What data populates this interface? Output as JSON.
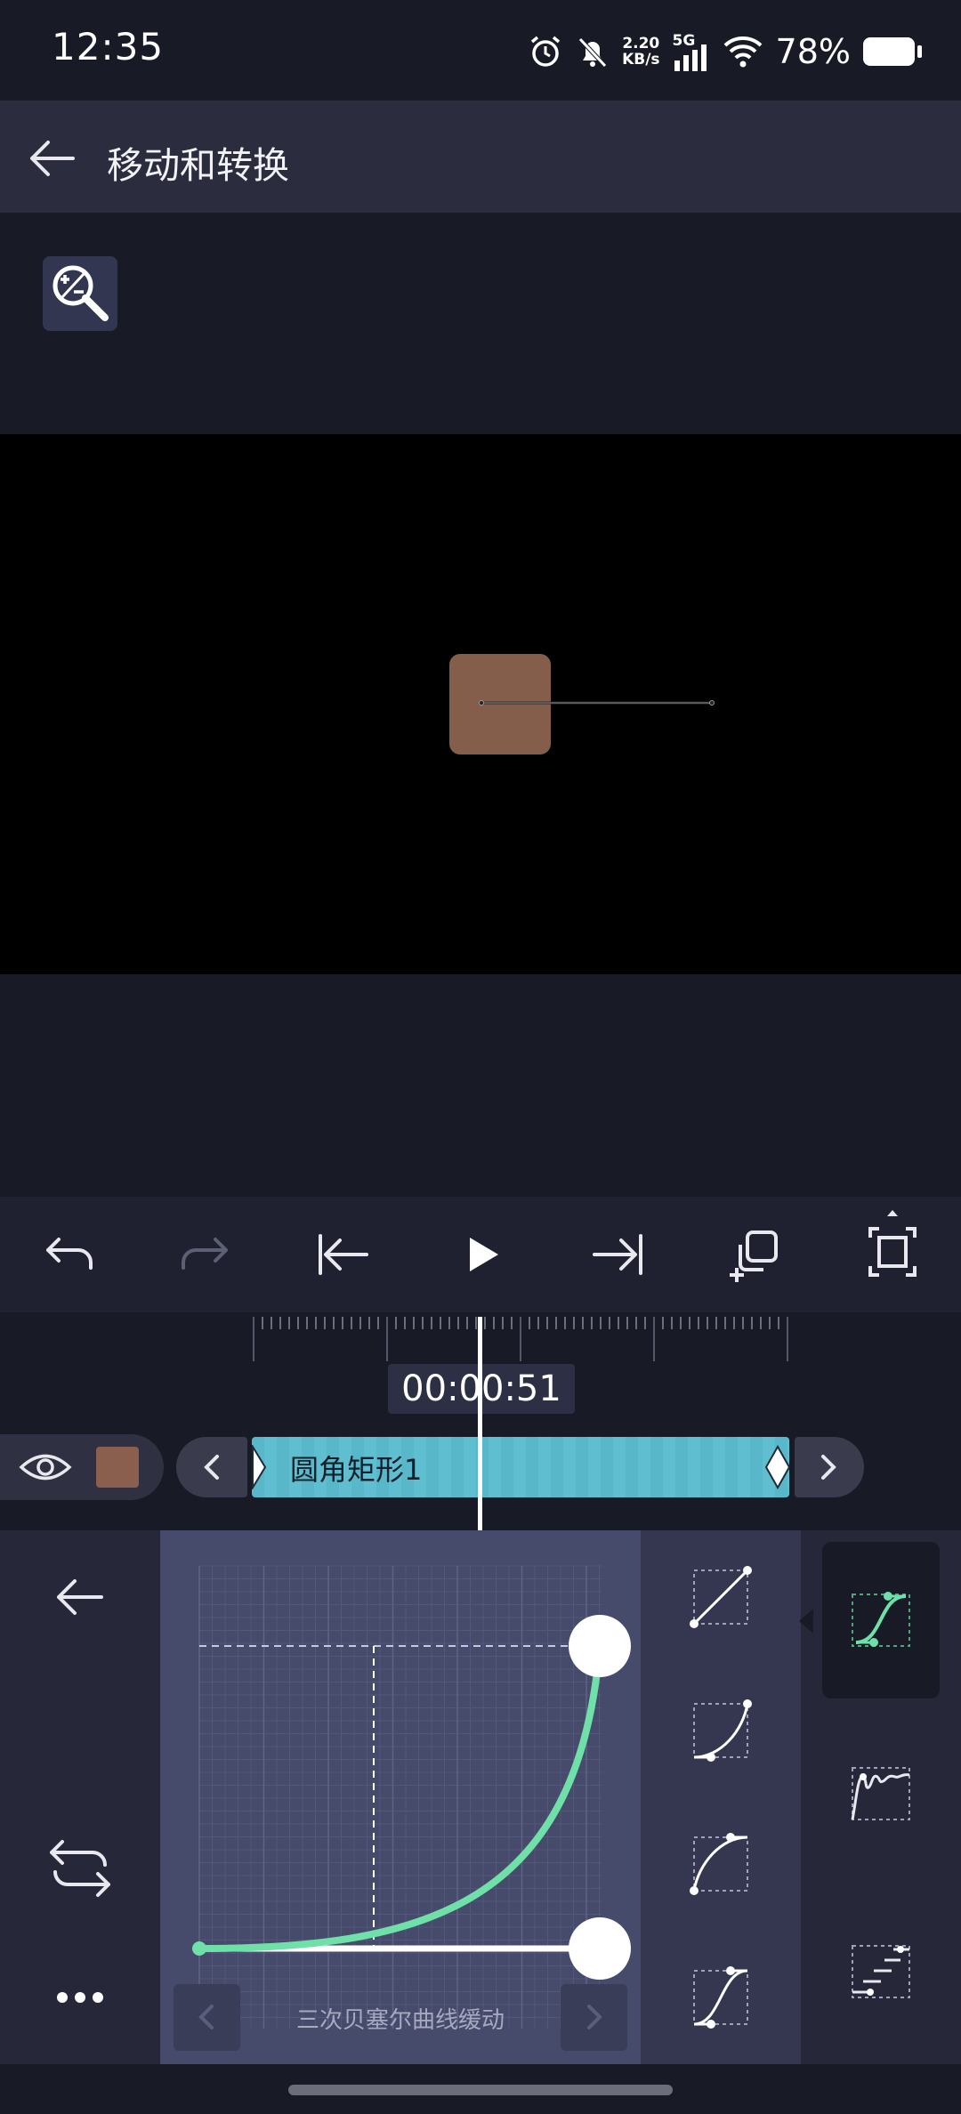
{
  "status_bar": {
    "time": "12:35",
    "net_speed_value": "2.20",
    "net_speed_unit": "KB/s",
    "network_type": "5G",
    "battery_percent": "78%",
    "icons": [
      "alarm-icon",
      "bell-off-icon",
      "signal-icon",
      "wifi-icon",
      "battery-icon"
    ]
  },
  "header": {
    "title": "移动和转换",
    "back_icon": "arrow-left-icon"
  },
  "toolbar": {
    "zoom_icon": "zoom-in-out-icon"
  },
  "canvas": {
    "shape_color": "#855d4b",
    "background": "#000000"
  },
  "controls": {
    "icons": [
      "undo-icon",
      "redo-icon",
      "skip-to-start-icon",
      "play-icon",
      "skip-to-end-icon",
      "duplicate-icon",
      "fullscreen-icon"
    ]
  },
  "timeline": {
    "timecode": "00:00:51",
    "clip_name": "圆角矩形1",
    "clip_color": "#58b8c9",
    "layer_color": "#8a5f4d"
  },
  "easing_panel": {
    "curve_name": "三次贝塞尔曲线缓动",
    "curve_color": "#6ee0a8",
    "side_icons": [
      "arrow-left-icon",
      "swap-icon",
      "more-icon"
    ],
    "presets": [
      "linear-curve-icon",
      "ease-in-curve-icon",
      "ease-out-curve-icon",
      "ease-in-out-curve-icon"
    ],
    "categories": [
      "bezier-category-icon",
      "bounce-category-icon",
      "steps-category-icon"
    ]
  }
}
